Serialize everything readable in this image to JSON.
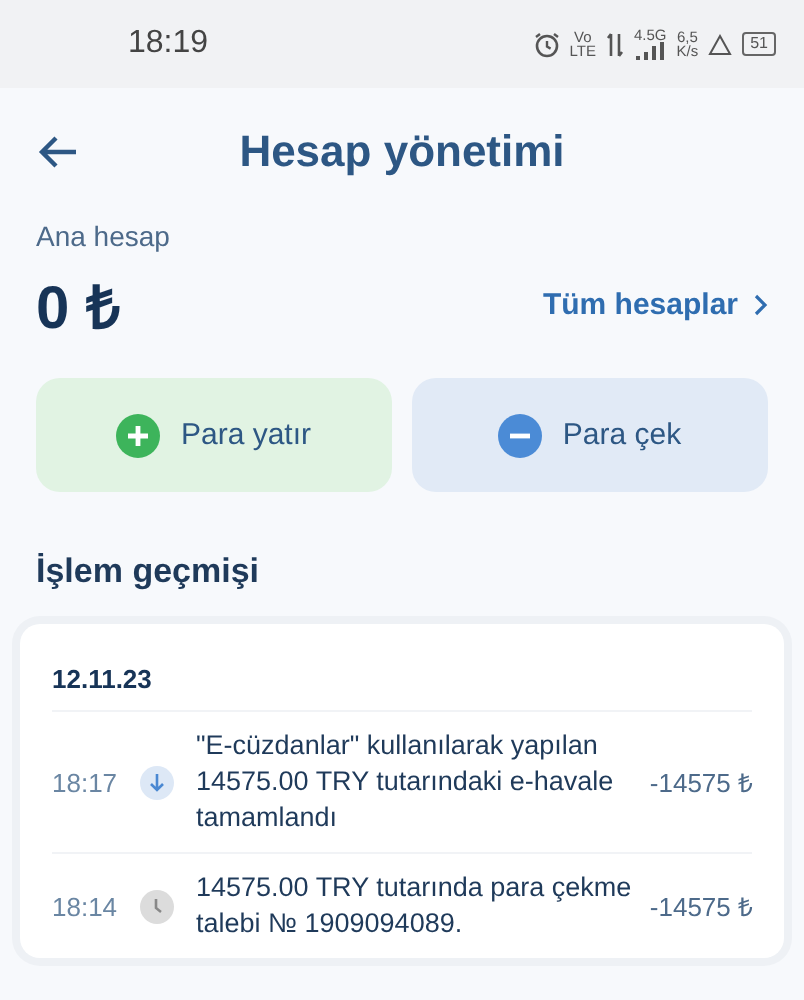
{
  "status_bar": {
    "time": "18:19",
    "volte_top": "Vo",
    "volte_bottom": "LTE",
    "network": "4.5G",
    "speed_value": "6,5",
    "speed_unit": "K/s",
    "battery": "51"
  },
  "header": {
    "title": "Hesap yönetimi"
  },
  "account": {
    "label": "Ana hesap",
    "balance": "0 ₺",
    "all_accounts_link": "Tüm hesaplar"
  },
  "actions": [
    {
      "kind": "deposit",
      "label": "Para yatır"
    },
    {
      "kind": "withdraw",
      "label": "Para çek"
    }
  ],
  "history": {
    "title": "İşlem geçmişi",
    "date": "12.11.23",
    "transactions": [
      {
        "time": "18:17",
        "kind": "completed",
        "description": "\"E-cüzdanlar\" kullanılarak yapılan 14575.00 TRY tutarındaki e-havale tamamlandı",
        "amount": "-14575 ₺"
      },
      {
        "time": "18:14",
        "kind": "pending",
        "description": "14575.00 TRY tutarında para çekme talebi № 1909094089.",
        "amount": "-14575 ₺"
      }
    ]
  }
}
